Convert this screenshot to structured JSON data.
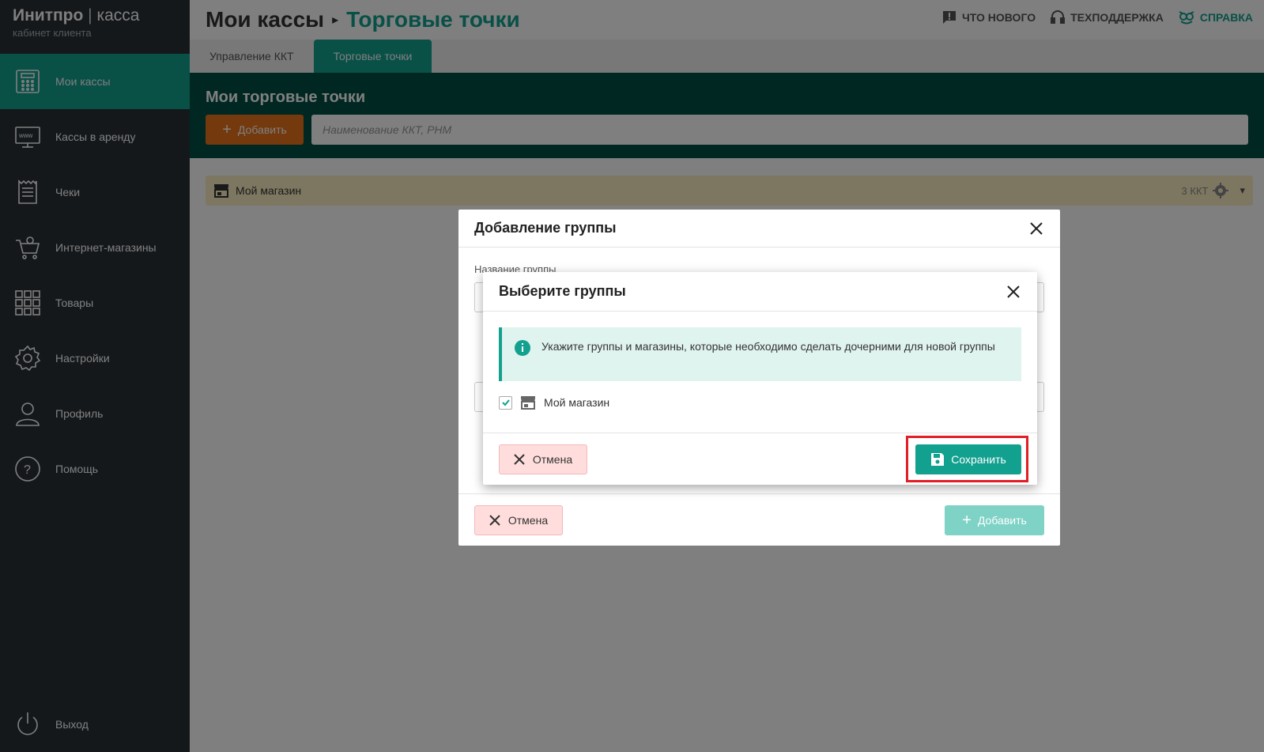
{
  "brand": {
    "name": "Инитпро",
    "separator": " | ",
    "product": "касса",
    "subtitle": "кабинет клиента"
  },
  "sidebar": {
    "items": [
      {
        "label": "Мои кассы",
        "icon": "cash-register-icon"
      },
      {
        "label": "Кассы в аренду",
        "icon": "monitor-www-icon"
      },
      {
        "label": "Чеки",
        "icon": "receipt-icon"
      },
      {
        "label": "Интернет-магазины",
        "icon": "shopping-cart-icon"
      },
      {
        "label": "Товары",
        "icon": "grid-icon"
      },
      {
        "label": "Настройки",
        "icon": "gear-icon"
      },
      {
        "label": "Профиль",
        "icon": "user-icon"
      },
      {
        "label": "Помощь",
        "icon": "question-icon"
      }
    ],
    "exit": {
      "label": "Выход",
      "icon": "power-icon"
    }
  },
  "header": {
    "crumb_parent": "Мои кассы",
    "crumb_current": "Торговые точки",
    "links": {
      "news": "ЧТО НОВОГО",
      "support": "ТЕХПОДДЕРЖКА",
      "help": "СПРАВКА"
    }
  },
  "tabs": [
    {
      "label": "Управление ККТ"
    },
    {
      "label": "Торговые точки"
    }
  ],
  "band": {
    "title": "Мои торговые точки",
    "add_label": "Добавить",
    "search_placeholder": "Наименование ККТ, РНМ"
  },
  "shop_row": {
    "name": "Мой магазин",
    "count": "3 ККТ"
  },
  "modal_outer": {
    "title": "Добавление группы",
    "field_label": "Название группы",
    "cancel_label": "Отмена",
    "add_label": "Добавить"
  },
  "modal_inner": {
    "title": "Выберите группы",
    "info_text": "Укажите группы и магазины, которые необходимо сделать дочерними для новой группы",
    "item_label": "Мой магазин",
    "item_checked": true,
    "cancel_label": "Отмена",
    "save_label": "Сохранить"
  },
  "colors": {
    "accent": "#12a08f",
    "sidebar": "#2b3036",
    "band": "#004f44",
    "orange": "#e8731a",
    "highlight": "#e21e26"
  }
}
